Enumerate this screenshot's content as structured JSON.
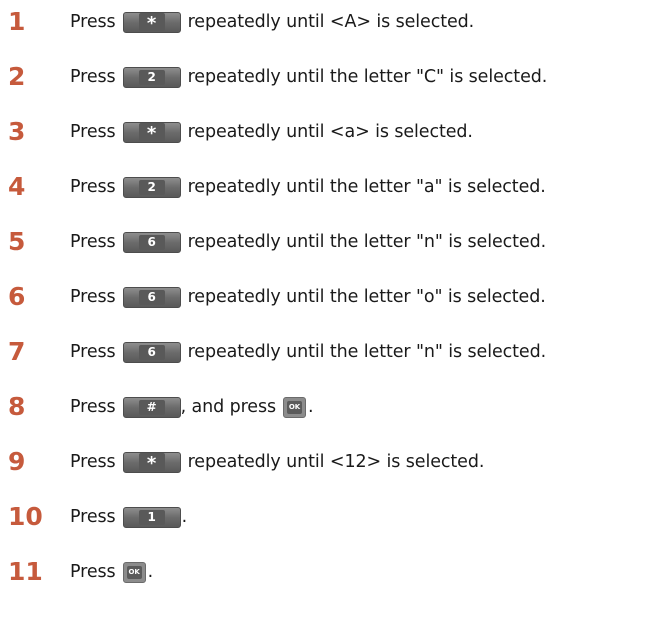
{
  "steps": [
    {
      "num": "1",
      "pre": "Press",
      "key": "*",
      "post": "repeatedly until <A> is selected."
    },
    {
      "num": "2",
      "pre": "Press",
      "key": "2",
      "post": "repeatedly until the letter \"C\" is selected."
    },
    {
      "num": "3",
      "pre": "Press",
      "key": "*",
      "post": "repeatedly until <a> is selected."
    },
    {
      "num": "4",
      "pre": "Press",
      "key": "2",
      "post": "repeatedly until the letter \"a\" is selected."
    },
    {
      "num": "5",
      "pre": "Press",
      "key": "6",
      "post": "repeatedly until the letter \"n\" is selected."
    },
    {
      "num": "6",
      "pre": "Press",
      "key": "6",
      "post": "repeatedly until the letter \"o\" is selected."
    },
    {
      "num": "7",
      "pre": "Press",
      "key": "6",
      "post": "repeatedly until the letter \"n\" is selected."
    },
    {
      "num": "8",
      "pre": "Press",
      "key": "#",
      "post": ", and press",
      "ok_key": "OK",
      "end": "."
    },
    {
      "num": "9",
      "pre": "Press",
      "key": "*",
      "post": "repeatedly until <12> is selected."
    },
    {
      "num": "10",
      "pre": "Press",
      "key": "1",
      "post": "."
    },
    {
      "num": "11",
      "pre": "Press",
      "ok_key": "OK",
      "end": "."
    }
  ],
  "colors": {
    "step_number": "#c65a3c",
    "key_body": "#6b6b6b",
    "key_face": "#595959"
  },
  "icons": {
    "key": "keypad-button-icon",
    "ok": "ok-button-icon"
  }
}
